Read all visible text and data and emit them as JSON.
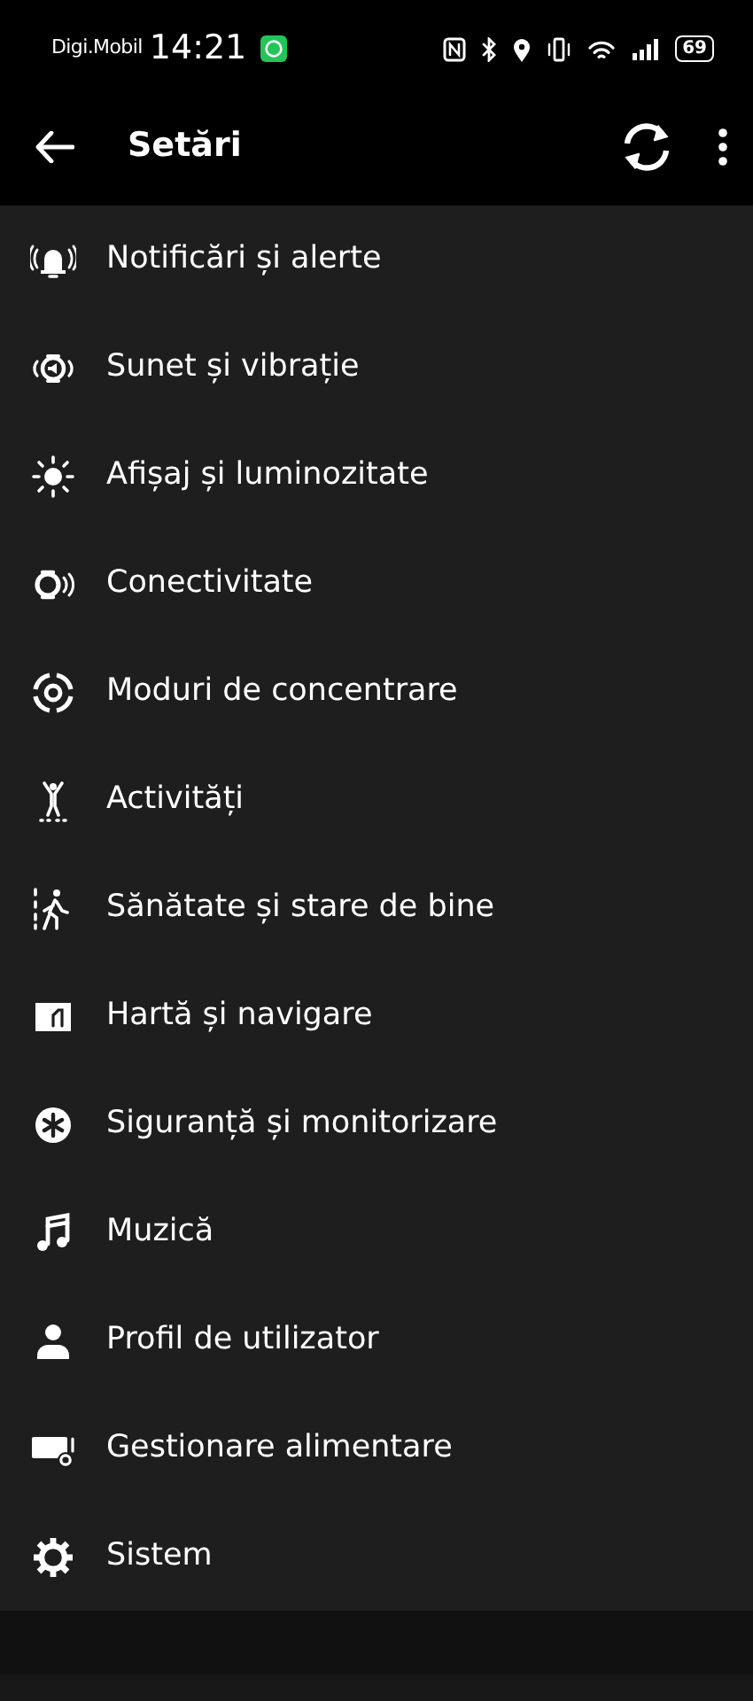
{
  "status_bar": {
    "carrier": "Digi.Mobil",
    "time": "14:21",
    "battery": "69"
  },
  "app_bar": {
    "title": "Setări"
  },
  "items": [
    {
      "label": "Notificări și alerte"
    },
    {
      "label": "Sunet și vibrație"
    },
    {
      "label": "Afișaj și luminozitate"
    },
    {
      "label": "Conectivitate"
    },
    {
      "label": "Moduri de concentrare"
    },
    {
      "label": "Activități"
    },
    {
      "label": "Sănătate și stare de bine"
    },
    {
      "label": "Hartă și navigare"
    },
    {
      "label": "Siguranță și monitorizare"
    },
    {
      "label": "Muzică"
    },
    {
      "label": "Profil de utilizator"
    },
    {
      "label": "Gestionare alimentare"
    },
    {
      "label": "Sistem"
    }
  ]
}
